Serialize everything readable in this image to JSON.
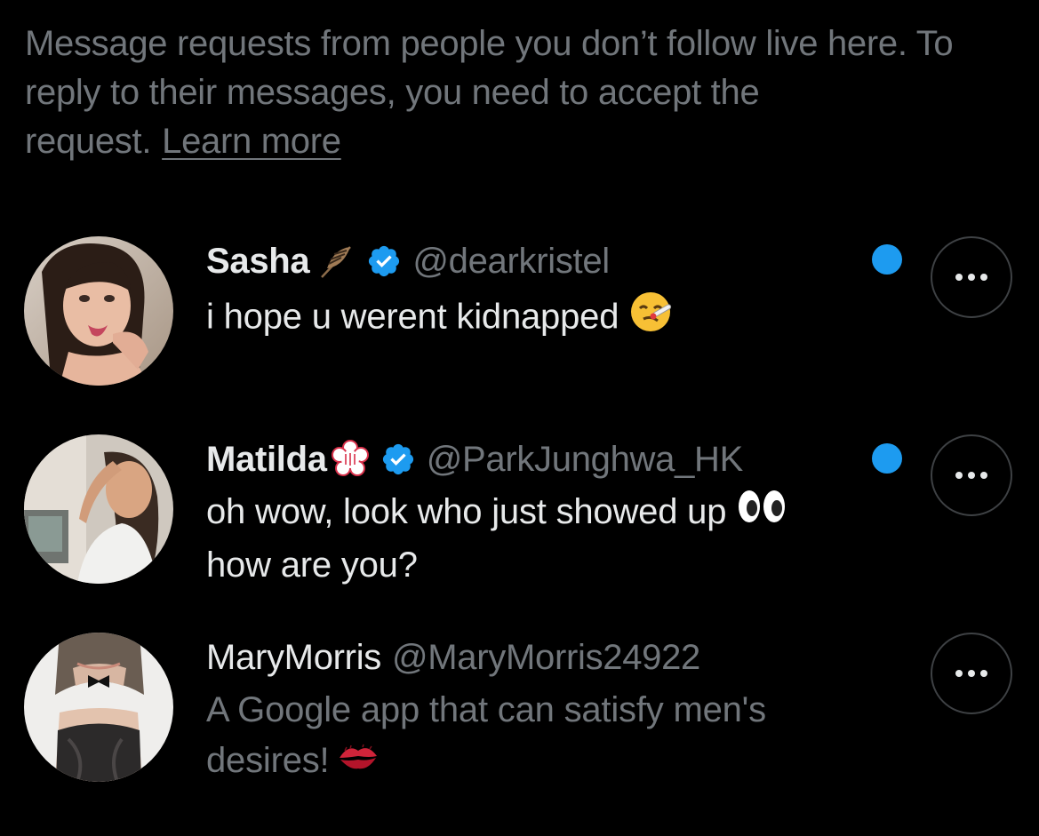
{
  "notice": {
    "text": "Message requests from people you don’t follow live here. To reply to their messages, you need to accept the request.",
    "link_label": "Learn more"
  },
  "accent_color": "#1d9bf0",
  "requests": [
    {
      "name": "Sasha",
      "name_emoji": "feather-icon",
      "verified": true,
      "handle": "@dearkristel",
      "message": "i hope u werent kidnapped",
      "message_emoji": "face-with-thermometer-emoji",
      "unread": true,
      "more_icon": "more-horizontal-icon"
    },
    {
      "name": "Matilda",
      "name_emoji": "cherry-blossom-stamp-icon",
      "verified": true,
      "handle": "@ParkJunghwa_HK",
      "message_line1": "oh wow, look who just showed up",
      "message_emoji": "eyes-emoji",
      "message_line2": "how are you?",
      "unread": true,
      "more_icon": "more-horizontal-icon"
    },
    {
      "name": "MaryMorris",
      "verified": false,
      "handle": "@MaryMorris24922",
      "message_line1": "A Google app that can satisfy men's",
      "message_line2": "desires!",
      "message_emoji": "kiss-mark-emoji",
      "unread": false,
      "more_icon": "more-horizontal-icon"
    }
  ]
}
